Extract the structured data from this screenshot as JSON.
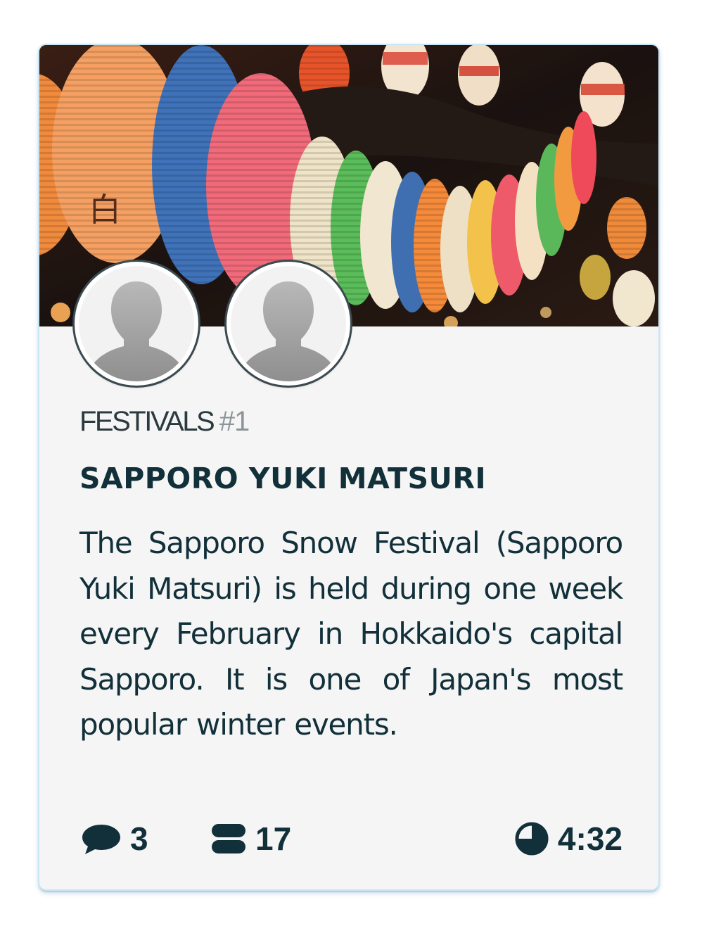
{
  "card": {
    "category": "FESTIVALS",
    "category_number": "#1",
    "title": "SAPPORO YUKI MATSURI",
    "description": "The Sapporo Snow Festival (Sapporo Yuki Matsuri) is held during one week every February in Hokkaido's capital Sapporo. It is one of Japan's most popular winter events.",
    "hero_image": "paper-lanterns-photo",
    "avatars": [
      {
        "icon": "user-silhouette-icon"
      },
      {
        "icon": "user-silhouette-icon"
      }
    ],
    "stats": {
      "comments": {
        "icon": "speech-bubble-icon",
        "value": "3"
      },
      "lessons": {
        "icon": "stacked-bars-icon",
        "value": "17"
      },
      "duration": {
        "icon": "pie-clock-icon",
        "value": "4:32"
      }
    }
  },
  "colors": {
    "text_dark": "#12303a",
    "category_number": "#8b9598",
    "card_background": "#f5f5f5"
  }
}
